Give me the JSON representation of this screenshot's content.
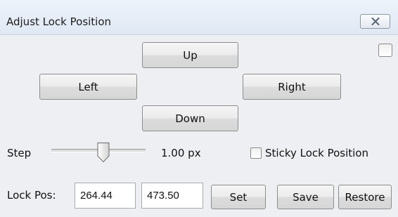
{
  "window": {
    "title": "Adjust Lock Position",
    "close_icon": "close-x-icon"
  },
  "nav": {
    "up_label": "Up",
    "left_label": "Left",
    "right_label": "Right",
    "down_label": "Down"
  },
  "step": {
    "label": "Step",
    "value_text": "1.00 px",
    "slider_fraction": 0.55
  },
  "sticky": {
    "label": "Sticky Lock Position",
    "checked": false
  },
  "corner_checkbox": {
    "checked": false
  },
  "lock_pos": {
    "label": "Lock Pos:",
    "x_value": "264.44",
    "y_value": "473.50"
  },
  "actions": {
    "set_label": "Set",
    "save_label": "Save",
    "restore_label": "Restore"
  },
  "colors": {
    "titlebar": "#dfe8f4",
    "panel": "#eeeff2",
    "button_border": "#8d8d8d"
  }
}
